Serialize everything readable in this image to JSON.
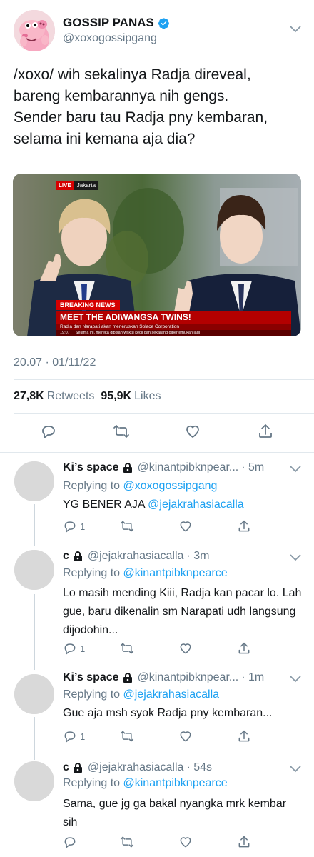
{
  "tweet": {
    "author_name": "GOSSIP PANAS",
    "author_handle": "@xoxogossipgang",
    "text": "/xoxo/ wih sekalinya Radja direveal,\nbareng kembarannya nih gengs.\nSender baru tau Radja pny kembaran,\nselama ini kemana aja dia?",
    "timestamp": "20.07 · 01/11/22",
    "retweets_count": "27,8K",
    "retweets_label": "Retweets",
    "likes_count": "95,9K",
    "likes_label": "Likes",
    "avatar_icon": "pig-cartoon-avatar",
    "verified_icon": "verified-badge-icon",
    "verified_color": "#1da1f2"
  },
  "media": {
    "live_label": "LIVE",
    "live_location": "Jakarta",
    "breaking_label": "BREAKING NEWS",
    "headline": "MEET THE ADIWANGSA TWINS!",
    "subheadline": "Radja dan Narapati akan meneruskan Solace Corporation",
    "ticker_time": "19:07",
    "ticker_text": "Selama ini, mereka dipisah waktu kecil dan sekarang dipertemukan lagi",
    "news_red": "#d50000"
  },
  "replies": [
    {
      "name": "Ki’s space",
      "handle": "@kinantpibknpear...",
      "time": "· 5m",
      "replying_prefix": "Replying to",
      "replying_to": "@xoxogossipgang",
      "text": "YG BENER AJA",
      "mention": "@jejakrahasiacalla",
      "reply_count": "1"
    },
    {
      "name": "c",
      "handle": "@jejakrahasiacalla",
      "time": "· 3m",
      "replying_prefix": "Replying to",
      "replying_to": "@kinantpibknpearce",
      "text": "Lo masih mending Kiii, Radja kan pacar lo. Lah gue, baru dikenalin sm Narapati udh langsung dijodohin...",
      "reply_count": "1"
    },
    {
      "name": "Ki’s space",
      "handle": "@kinantpibknpear...",
      "time": "· 1m",
      "replying_prefix": "Replying to",
      "replying_to": "@jejakrahasiacalla",
      "text": "Gue aja msh syok Radja pny kembaran...",
      "reply_count": "1"
    },
    {
      "name": "c",
      "handle": "@jejakrahasiacalla",
      "time": "· 54s",
      "replying_prefix": "Replying to",
      "replying_to": "@kinantpibknpearce",
      "text": "Sama, gue jg ga bakal nyangka mrk kembar sih",
      "reply_count": ""
    }
  ],
  "colors": {
    "link_blue": "#1da1f2",
    "secondary_text": "#657786",
    "divider": "#e1e8ed"
  }
}
